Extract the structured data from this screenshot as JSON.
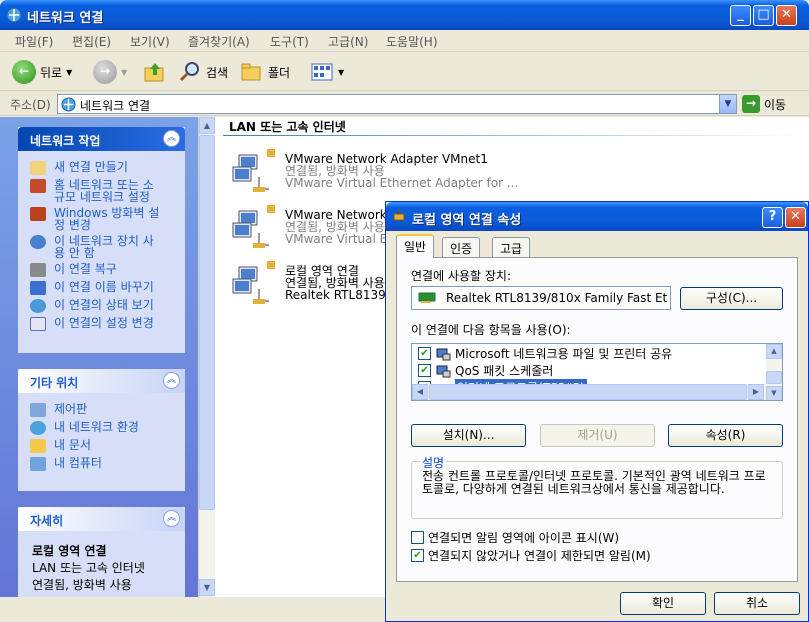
{
  "window": {
    "title": "네트워크 연결",
    "buttons": {
      "minimize": "_",
      "maximize": "□",
      "close": "✕"
    }
  },
  "menu": [
    "파일(F)",
    "편집(E)",
    "보기(V)",
    "즐겨찾기(A)",
    "도구(T)",
    "고급(N)",
    "도움말(H)"
  ],
  "toolbar": {
    "back": "뒤로",
    "search": "검색",
    "folders": "폴더"
  },
  "address": {
    "label": "주소(D)",
    "value": "네트워크 연결",
    "go": "이동"
  },
  "sidebar": {
    "network_tasks": {
      "title": "네트워크 작업",
      "items": [
        {
          "l1": "새 연결 만들기",
          "l2": ""
        },
        {
          "l1": "홈 네트워크 또는 소",
          "l2": "규모 네트워크 설정"
        },
        {
          "l1": "Windows 방화벽 설",
          "l2": "정 변경"
        },
        {
          "l1": "이 네트워크 장치 사",
          "l2": "용 안 함"
        },
        {
          "l1": "이 연결 복구",
          "l2": ""
        },
        {
          "l1": "이 연결 이름 바꾸기",
          "l2": ""
        },
        {
          "l1": "이 연결의 상태 보기",
          "l2": ""
        },
        {
          "l1": "이 연결의 설정 변경",
          "l2": ""
        }
      ]
    },
    "other_places": {
      "title": "기타 위치",
      "items": [
        "제어판",
        "내 네트워크 환경",
        "내 문서",
        "내 컴퓨터"
      ]
    },
    "details": {
      "title": "자세히",
      "name": "로컬 영역 연결",
      "line1": "LAN 또는 고속 인터넷",
      "line2": "연결됨, 방화벽 사용"
    }
  },
  "main": {
    "group_title": "LAN 또는 고속 인터넷",
    "connections": [
      {
        "name": "VMware Network Adapter VMnet1",
        "status": "연결됨, 방화벽 사용",
        "device": "VMware Virtual Ethernet Adapter for ..."
      },
      {
        "name": "VMware Network",
        "status": "연결됨, 방화벽 사용",
        "device": "VMware Virtual Et"
      },
      {
        "name": "로컬 영역 연결",
        "status": "연결됨, 방화벽 사용",
        "device": "Realtek RTL8139/8"
      }
    ]
  },
  "dialog": {
    "title": "로컬 영역 연결 속성",
    "help": "?",
    "close": "✕",
    "tabs": [
      "일반",
      "인증",
      "고급"
    ],
    "connect_using_label": "연결에 사용할 장치:",
    "device": "Realtek RTL8139/810x Family Fast Et",
    "configure": "구성(C)...",
    "items_label": "이 연결에 다음 항목을 사용(O):",
    "items": [
      {
        "label": "Microsoft 네트워크용 파일 및 프린터 공유",
        "checked": true,
        "selected": false
      },
      {
        "label": "QoS 패킷 스케줄러",
        "checked": true,
        "selected": false
      },
      {
        "label": "인터넷 프로토콜(TCP/IP)",
        "checked": true,
        "selected": true
      }
    ],
    "install": "설치(N)...",
    "uninstall": "제거(U)",
    "properties": "속성(R)",
    "description_title": "설명",
    "description": "전송 컨트롤 프로토콜/인터넷 프로토콜. 기본적인 광역 네트워크 프로토콜로, 다양하게 연결된 네트워크상에서 통신을 제공합니다.",
    "option1": "연결되면 알림 영역에 아이콘 표시(W)",
    "option1_checked": false,
    "option2": "연결되지 않았거나 연결이 제한되면 알림(M)",
    "option2_checked": true,
    "ok": "확인",
    "cancel": "취소"
  }
}
